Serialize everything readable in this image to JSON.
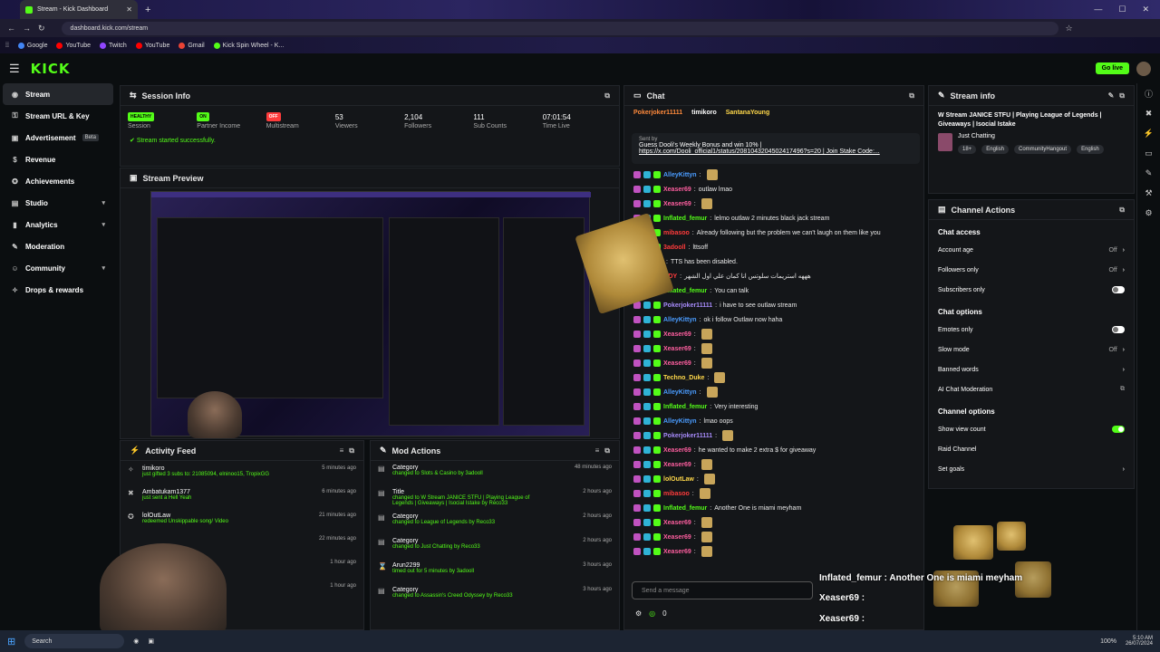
{
  "browser": {
    "tab_title": "Stream - Kick Dashboard",
    "url": "dashboard.kick.com/stream",
    "bookmarks": [
      "Google",
      "YouTube",
      "Twitch",
      "YouTube",
      "Gmail",
      "Kick Spin Wheel - K..."
    ]
  },
  "header": {
    "logo": "KICK",
    "go_live": "Go live"
  },
  "sidebar": {
    "items": [
      {
        "label": "Stream",
        "icon": "broadcast-icon",
        "glyph": "◉",
        "active": true
      },
      {
        "label": "Stream URL & Key",
        "icon": "key-icon",
        "glyph": "⚿"
      },
      {
        "label": "Advertisement",
        "icon": "megaphone-icon",
        "glyph": "▣",
        "badge": "Beta"
      },
      {
        "label": "Revenue",
        "icon": "dollar-icon",
        "glyph": "$"
      },
      {
        "label": "Achievements",
        "icon": "trophy-icon",
        "glyph": "✪"
      },
      {
        "label": "Studio",
        "icon": "studio-icon",
        "glyph": "▤",
        "chev": true
      },
      {
        "label": "Analytics",
        "icon": "chart-icon",
        "glyph": "▮",
        "chev": true
      },
      {
        "label": "Moderation",
        "icon": "hammer-icon",
        "glyph": "✎"
      },
      {
        "label": "Community",
        "icon": "people-icon",
        "glyph": "☺",
        "chev": true
      },
      {
        "label": "Drops & rewards",
        "icon": "gift-icon",
        "glyph": "✧"
      }
    ]
  },
  "session": {
    "title": "Session Info",
    "stats": [
      {
        "value": "HEALTHY",
        "label": "Session",
        "badge_color": "#53fc18"
      },
      {
        "value": "ON",
        "label": "Partner Income",
        "badge_color": "#53fc18"
      },
      {
        "value": "OFF",
        "label": "Multistream",
        "badge_color": "#ff3b3b"
      },
      {
        "value": "53",
        "label": "Viewers"
      },
      {
        "value": "2,104",
        "label": "Followers"
      },
      {
        "value": "111",
        "label": "Sub Counts"
      },
      {
        "value": "07:01:54",
        "label": "Time Live"
      }
    ],
    "message": "Stream started successfully."
  },
  "preview": {
    "title": "Stream Preview"
  },
  "activity": {
    "title": "Activity Feed",
    "rows": [
      {
        "name": "timikoro",
        "detail": "just gifted 3 subs to: 21085094, elninoo15, TropixGG",
        "time": "5 minutes ago",
        "icon": "gift-icon",
        "glyph": "✧"
      },
      {
        "name": "Ambatukam1377",
        "detail": "just sent a Hell Yeah",
        "time": "6 minutes ago",
        "icon": "user-icon",
        "glyph": "✖"
      },
      {
        "name": "lolOutLaw",
        "detail": "redeemed Unskippable song/ Video",
        "time": "21 minutes ago",
        "icon": "star-icon",
        "glyph": "✪"
      },
      {
        "name": "",
        "detail": "",
        "time": "22 minutes ago",
        "icon": "star-icon",
        "glyph": ""
      },
      {
        "name": "",
        "detail": "",
        "time": "1 hour ago",
        "icon": "star-icon",
        "glyph": ""
      },
      {
        "name": "",
        "detail": "",
        "time": "1 hour ago",
        "icon": "star-icon",
        "glyph": ""
      }
    ]
  },
  "mod": {
    "title": "Mod Actions",
    "rows": [
      {
        "name": "Category",
        "detail": "changed to Slots & Casino by 3adooll",
        "time": "48 minutes ago",
        "glyph": "▤"
      },
      {
        "name": "Title",
        "detail": "changed to W Stream JANICE STFU | Playing League of Legends | Giveaways | Isocial Istake by Reco33",
        "time": "2 hours ago",
        "glyph": "▤"
      },
      {
        "name": "Category",
        "detail": "changed to League of Legends by Reco33",
        "time": "2 hours ago",
        "glyph": "▤"
      },
      {
        "name": "Category",
        "detail": "changed to Just Chatting by Reco33",
        "time": "2 hours ago",
        "glyph": "▤"
      },
      {
        "name": "Arun2299",
        "detail": "timed out for 5 minutes by 3adooll",
        "time": "3 hours ago",
        "glyph": "⌛"
      },
      {
        "name": "Category",
        "detail": "changed to Assassin's Creed Odyssey by Reco33",
        "time": "3 hours ago",
        "glyph": "▤"
      }
    ]
  },
  "chat": {
    "title": "Chat",
    "top_users": [
      "Pokerjoker11111",
      "timikoro",
      "SantanaYoung"
    ],
    "pinned": {
      "by": "Sent by",
      "line": "Guess Dooli's Weekly Bonus and win 10% |",
      "link": "https://x.com/Dooli_official1/status/2081043204502417496?s=20 | Join Stake Code:..."
    },
    "messages": [
      {
        "user": "AlleyKittyn",
        "color": "#4a9cff",
        "text": "",
        "emote": true
      },
      {
        "user": "Xeaser69",
        "color": "#ff5fa0",
        "text": "outlaw lmao"
      },
      {
        "user": "Xeaser69",
        "color": "#ff5fa0",
        "text": "",
        "emote": true
      },
      {
        "user": "Inflated_femur",
        "color": "#53fc18",
        "text": "lelmo outlaw 2 minutes black jack stream"
      },
      {
        "user": "mibasoo",
        "color": "#ff3b3b",
        "text": "Already following but the problem we can't laugh on them like you"
      },
      {
        "user": "3adooll",
        "color": "#ff3b3b",
        "text": "lttsoff"
      },
      {
        "user": "",
        "color": "#fff",
        "text": "TTS has been disabled."
      },
      {
        "user": "ODY",
        "color": "#ff3b3b",
        "text": "هههه استريمات سلوتس انا كمان علي اول الشهر"
      },
      {
        "user": "Inflated_femur",
        "color": "#53fc18",
        "text": "You can talk"
      },
      {
        "user": "Pokerjoker11111",
        "color": "#a78bfa",
        "text": "i have to see outlaw stream"
      },
      {
        "user": "AlleyKittyn",
        "color": "#4a9cff",
        "text": "ok i follow Outlaw now haha"
      },
      {
        "user": "Xeaser69",
        "color": "#ff5fa0",
        "text": "",
        "emote": true
      },
      {
        "user": "Xeaser69",
        "color": "#ff5fa0",
        "text": "",
        "emote": true
      },
      {
        "user": "Xeaser69",
        "color": "#ff5fa0",
        "text": "",
        "emote": true
      },
      {
        "user": "Techno_Duke",
        "color": "#ffd84a",
        "text": "",
        "emote": true
      },
      {
        "user": "AlleyKittyn",
        "color": "#4a9cff",
        "text": "",
        "emote": true
      },
      {
        "user": "Inflated_femur",
        "color": "#53fc18",
        "text": "Very interesting"
      },
      {
        "user": "AlleyKittyn",
        "color": "#4a9cff",
        "text": "lmao oops"
      },
      {
        "user": "Pokerjoker11111",
        "color": "#a78bfa",
        "text": "",
        "emote": true
      },
      {
        "user": "Xeaser69",
        "color": "#ff5fa0",
        "text": "he wanted to make 2 extra $ for giveaway"
      },
      {
        "user": "Xeaser69",
        "color": "#ff5fa0",
        "text": "",
        "emote": true
      },
      {
        "user": "lolOutLaw",
        "color": "#ffd84a",
        "text": "",
        "emote": true
      },
      {
        "user": "mibasoo",
        "color": "#ff3b3b",
        "text": "",
        "emote": true
      },
      {
        "user": "Inflated_femur",
        "color": "#53fc18",
        "text": "Another One is miami meyham"
      },
      {
        "user": "Xeaser69",
        "color": "#ff5fa0",
        "text": "",
        "emote": true
      },
      {
        "user": "Xeaser69",
        "color": "#ff5fa0",
        "text": "",
        "emote": true
      },
      {
        "user": "Xeaser69",
        "color": "#ff5fa0",
        "text": "",
        "emote": true
      }
    ],
    "input_placeholder": "Send a message",
    "points": "0"
  },
  "stream_info": {
    "title": "Stream info",
    "stream_title": "W Stream JANICE STFU | Playing League of Legends | Giveaways | Isocial Istake",
    "category": "Just Chatting",
    "tags": [
      "18+",
      "English",
      "CommunityHangout",
      "English"
    ]
  },
  "channel_actions": {
    "title": "Channel Actions",
    "sections": [
      {
        "heading": "Chat access",
        "rows": [
          {
            "label": "Account age",
            "value": "Off",
            "kind": "chev"
          },
          {
            "label": "Followers only",
            "value": "Off",
            "kind": "chev"
          },
          {
            "label": "Subscribers only",
            "value": "",
            "kind": "toggle-off"
          }
        ]
      },
      {
        "heading": "Chat options",
        "rows": [
          {
            "label": "Emotes only",
            "value": "",
            "kind": "toggle-off"
          },
          {
            "label": "Slow mode",
            "value": "Off",
            "kind": "chev"
          },
          {
            "label": "Banned words",
            "value": "",
            "kind": "chev"
          },
          {
            "label": "AI Chat Moderation",
            "value": "",
            "kind": "ext"
          }
        ]
      },
      {
        "heading": "Channel options",
        "rows": [
          {
            "label": "Show view count",
            "value": "",
            "kind": "toggle-on"
          },
          {
            "label": "Raid Channel",
            "value": "",
            "kind": "none"
          },
          {
            "label": "Set goals",
            "value": "",
            "kind": "chev"
          }
        ]
      }
    ]
  },
  "overlay": {
    "names": [
      "Inflated_femur : Another One is miami meyham",
      "Xeaser69 :",
      "Xeaser69 :"
    ]
  },
  "taskbar": {
    "search": "Search",
    "time": "5:10 AM",
    "date": "26/07/2024",
    "battery": "100%"
  }
}
